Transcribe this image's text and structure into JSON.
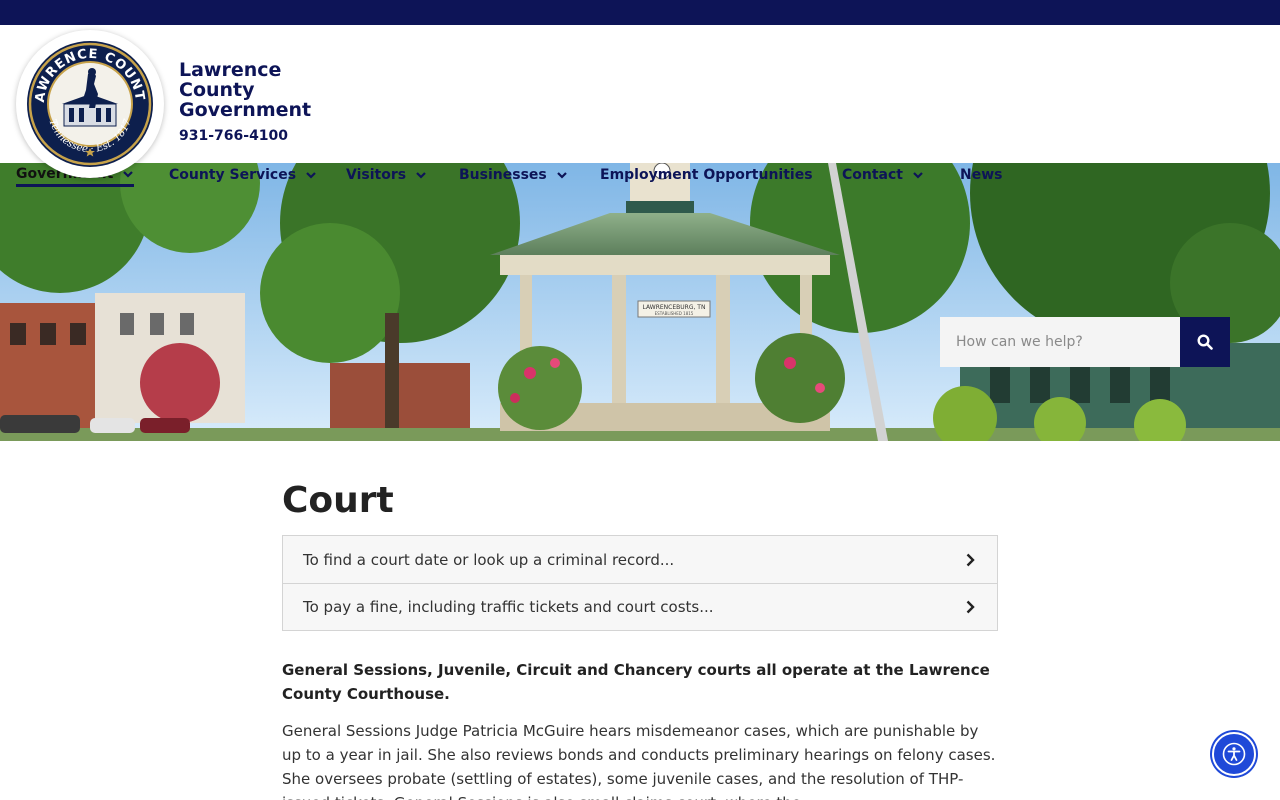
{
  "site": {
    "title": "Lawrence County Government",
    "phone": "931-766-4100",
    "seal_top_text": "LAWRENCE COUNTY",
    "seal_bottom_text": "Tennessee · Est. 1817",
    "brand_color": "#0d1457"
  },
  "nav": {
    "items": [
      {
        "label": "Government",
        "has_dropdown": true,
        "active": true
      },
      {
        "label": "County Services",
        "has_dropdown": true
      },
      {
        "label": "Visitors",
        "has_dropdown": true
      },
      {
        "label": "Businesses",
        "has_dropdown": true
      },
      {
        "label": "Employment Opportunities",
        "has_dropdown": false
      },
      {
        "label": "Contact",
        "has_dropdown": true
      },
      {
        "label": "News",
        "has_dropdown": false
      }
    ]
  },
  "hero": {
    "sign_text": "LAWRENCEBURG, TN",
    "sign_subtext": "ESTABLISHED 1815"
  },
  "search": {
    "placeholder": "How can we help?",
    "button_icon": "search-icon"
  },
  "main": {
    "title": "Court",
    "accordion": [
      {
        "label": "To find a court date or look up a criminal record..."
      },
      {
        "label": "To pay a fine, including traffic tickets and court costs..."
      }
    ],
    "lead": "General Sessions, Juvenile, Circuit and Chancery courts all operate at the Lawrence County Courthouse.",
    "body": "General Sessions Judge Patricia McGuire hears misdemeanor cases, which are punishable by up to a year in jail. She also reviews bonds and conducts preliminary hearings on felony cases. She oversees probate (settling of estates), some juvenile cases, and the resolution of THP-issued tickets. General Sessions is also small claims court, where the"
  },
  "accessibility": {
    "icon": "accessibility-icon",
    "color": "#1f49d8"
  }
}
